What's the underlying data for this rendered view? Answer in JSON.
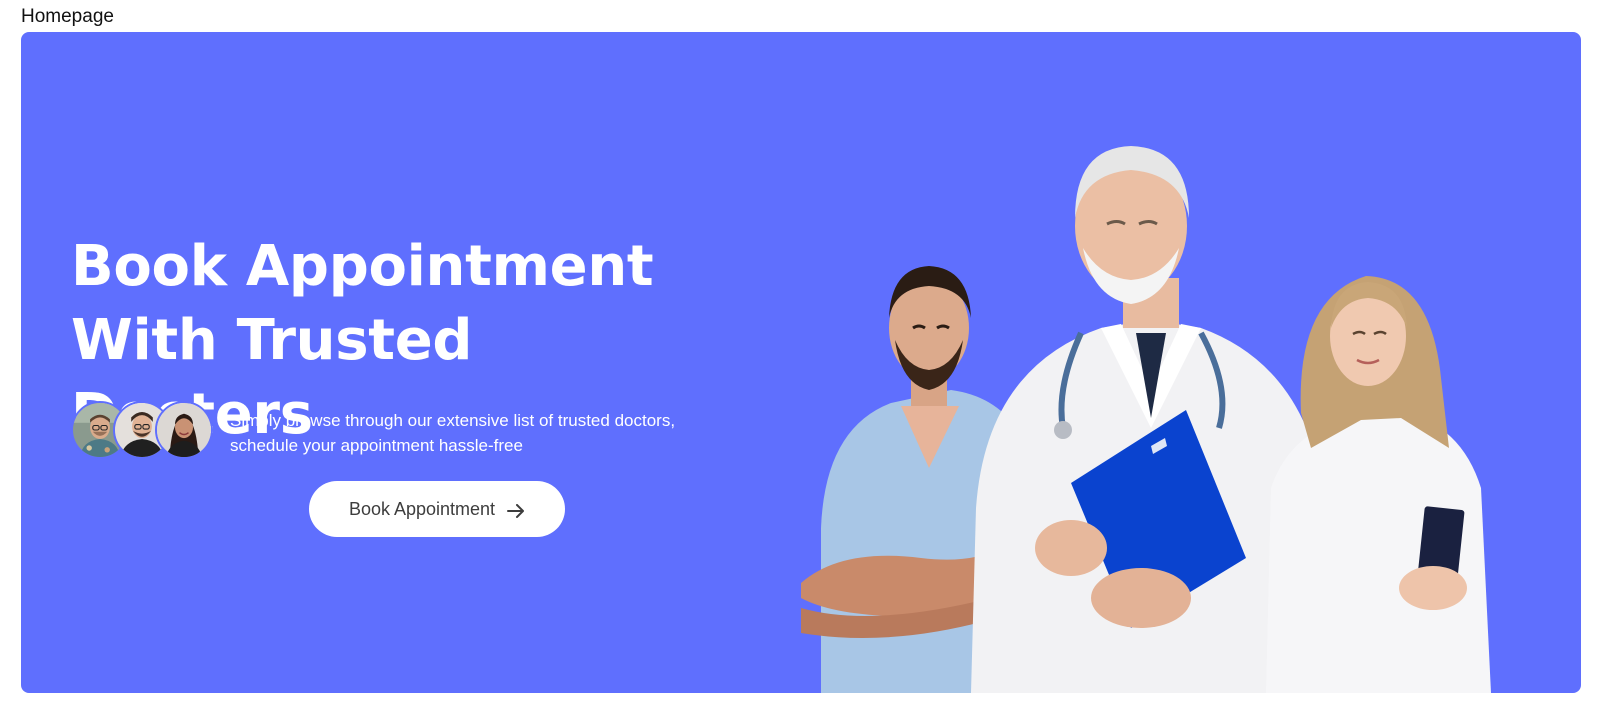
{
  "page": {
    "label": "Homepage"
  },
  "hero": {
    "headline_line1": "Book Appointment",
    "headline_line2": "With Trusted Docters",
    "subtext": "Simply browse through our extensive list of trusted doctors, schedule your appointment hassle-free",
    "cta_label": "Book Appointment",
    "cta_icon": "arrow-right-icon",
    "avatars": [
      "avatar-man-glasses",
      "avatar-man-beard",
      "avatar-woman"
    ],
    "background_color": "#5f6ffe"
  }
}
